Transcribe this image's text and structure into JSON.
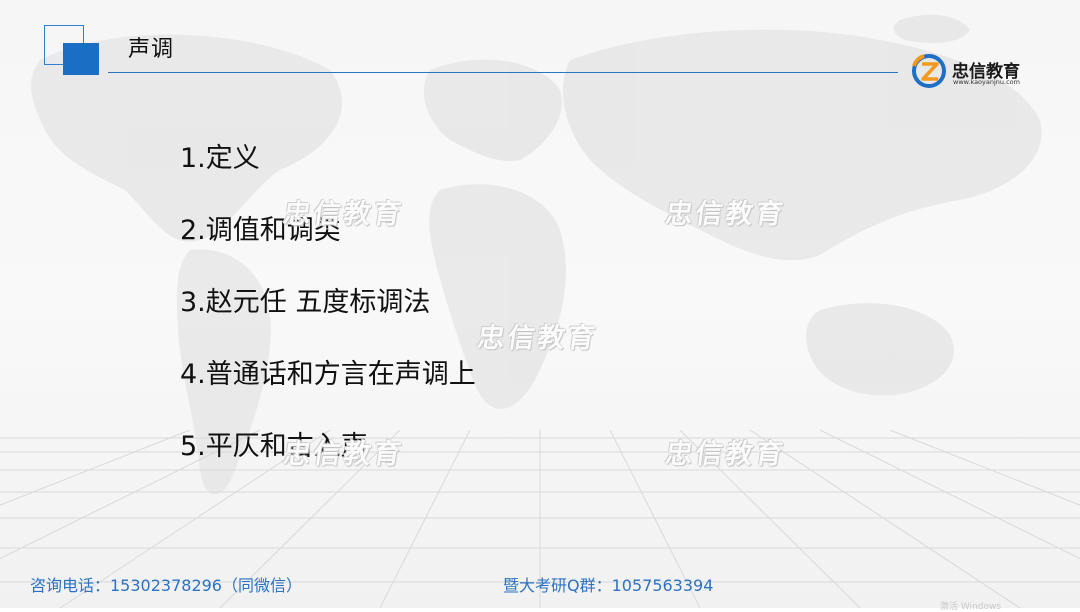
{
  "slide": {
    "title": "声调"
  },
  "logo": {
    "name": "忠信教育",
    "url": "www.kaoyanjnu.com",
    "mark_letter": "Z",
    "colors": {
      "blue": "#1f6fc5",
      "orange": "#f39a1e"
    }
  },
  "topics": [
    "1.定义",
    "2.调值和调类",
    "3.赵元任 五度标调法",
    "4.普通话和方言在声调上",
    "5.平仄和古入声"
  ],
  "watermark": {
    "text": "忠信教育"
  },
  "footer": {
    "consult": "咨询电话：15302378296（同微信）",
    "group": "暨大考研Q群：1057563394"
  },
  "corner_text": "激活 Windows",
  "colors": {
    "accent": "#1a6fc4",
    "footer": "#2b72c2",
    "title_rule": "#2a74c0"
  },
  "icons": {
    "header_decoration": "square-decoration-icon",
    "logo_mark": "z-logo-icon",
    "background": "world-map-icon"
  }
}
